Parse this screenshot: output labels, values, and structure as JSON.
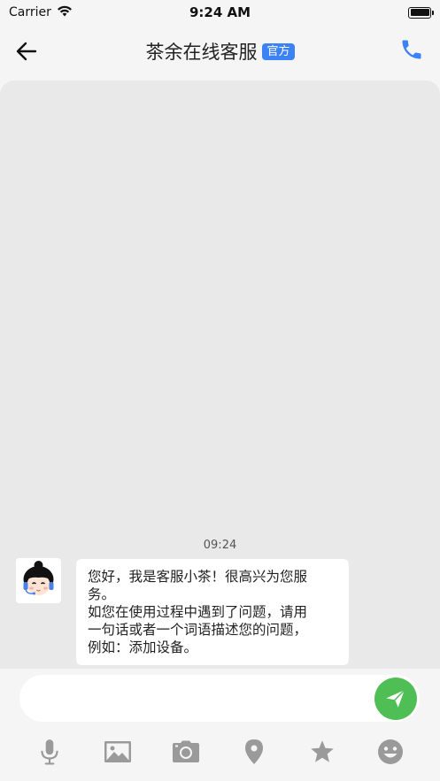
{
  "status_bar": {
    "carrier": "Carrier",
    "time": "9:24 AM"
  },
  "header": {
    "title": "茶余在线客服",
    "badge": "官方"
  },
  "chat": {
    "timestamp": "09:24",
    "messages": [
      {
        "sender": "service",
        "lines": [
          "您好，我是客服小茶！很高兴为您服",
          "务。",
          "如您在使用过程中遇到了问题，请用",
          "一句话或者一个词语描述您的问题，",
          "例如：添加设备。"
        ]
      }
    ]
  },
  "composer": {
    "value": "",
    "placeholder": ""
  },
  "toolbar": {
    "icons": [
      "microphone-icon",
      "image-icon",
      "camera-icon",
      "location-icon",
      "star-icon",
      "emoji-icon"
    ]
  },
  "colors": {
    "accent": "#3b82f6",
    "send": "#4fbf55",
    "icon": "#9a9a9a",
    "chat_bg": "#e9e9e9"
  }
}
